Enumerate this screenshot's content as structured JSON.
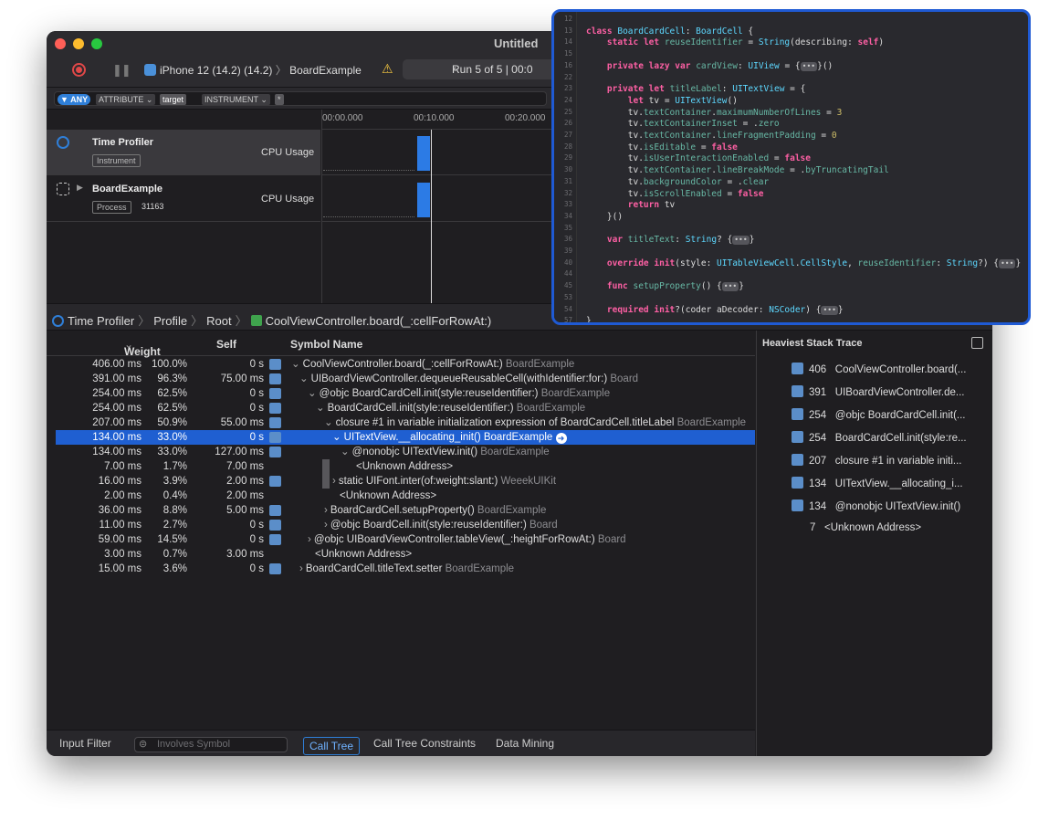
{
  "window": {
    "title": "Untitled"
  },
  "toolbar": {
    "device": "iPhone 12 (14.2) (14.2)",
    "device_sep": "〉",
    "target": "BoardExample",
    "run_prev": "‹",
    "run": "Run 5 of 5  |  00:0"
  },
  "filter": {
    "any": "▼ ANY",
    "attribute": "ATTRIBUTE ⌄",
    "target": "target",
    "instrument": "INSTRUMENT ⌄",
    "star": "*"
  },
  "ruler": [
    "00:00.000",
    "00:10.000",
    "00:20.000"
  ],
  "tracks": [
    {
      "name": "Time Profiler",
      "tag": "Instrument",
      "pid": "",
      "metric": "CPU Usage"
    },
    {
      "name": "BoardExample",
      "tag": "Process",
      "pid": "31163",
      "metric": "CPU Usage"
    }
  ],
  "breadcrumb": {
    "items": [
      "Time Profiler",
      "Profile",
      "Root",
      "CoolViewController.board(_:cellForRowAt:)"
    ],
    "sep": "〉"
  },
  "table": {
    "headers": {
      "weight": "Weight",
      "weight_sort": "⌄",
      "self": "Self",
      "symbol": "Symbol Name"
    },
    "rows": [
      {
        "w": "406.00 ms",
        "p": "100.0%",
        "s": "0 s",
        "icon": true,
        "indent": 0,
        "disc": "⌄",
        "sym": "CoolViewController.board(_:cellForRowAt:)",
        "lib": "BoardExample",
        "sel": false
      },
      {
        "w": "391.00 ms",
        "p": "96.3%",
        "s": "75.00 ms",
        "icon": true,
        "indent": 1,
        "disc": "⌄",
        "sym": "UIBoardViewController.dequeueReusableCell(withIdentifier:for:)",
        "lib": "Board",
        "sel": false
      },
      {
        "w": "254.00 ms",
        "p": "62.5%",
        "s": "0 s",
        "icon": true,
        "indent": 2,
        "disc": "⌄",
        "sym": "@objc BoardCardCell.init(style:reuseIdentifier:)",
        "lib": "BoardExample",
        "sel": false
      },
      {
        "w": "254.00 ms",
        "p": "62.5%",
        "s": "0 s",
        "icon": true,
        "indent": 3,
        "disc": "⌄",
        "sym": "BoardCardCell.init(style:reuseIdentifier:)",
        "lib": "BoardExample",
        "sel": false
      },
      {
        "w": "207.00 ms",
        "p": "50.9%",
        "s": "55.00 ms",
        "icon": true,
        "indent": 4,
        "disc": "⌄",
        "sym": "closure #1 in variable initialization expression of BoardCardCell.titleLabel",
        "lib": "BoardExample",
        "sel": false
      },
      {
        "w": "134.00 ms",
        "p": "33.0%",
        "s": "0 s",
        "icon": true,
        "indent": 5,
        "disc": "⌄",
        "sym": "UITextView.__allocating_init()",
        "lib": "BoardExample",
        "sel": true
      },
      {
        "w": "134.00 ms",
        "p": "33.0%",
        "s": "127.00 ms",
        "icon": true,
        "indent": 6,
        "disc": "⌄",
        "sym": "@nonobjc UITextView.init()",
        "lib": "BoardExample",
        "sel": false
      },
      {
        "w": "7.00 ms",
        "p": "1.7%",
        "s": "7.00 ms",
        "icon": false,
        "indent": 7,
        "disc": "",
        "sym": "<Unknown Address>",
        "lib": "",
        "sel": false
      },
      {
        "w": "16.00 ms",
        "p": "3.9%",
        "s": "2.00 ms",
        "icon": true,
        "indent": 5,
        "disc": "›",
        "sym": "static UIFont.inter(of:weight:slant:)",
        "lib": "WeeekUIKit",
        "sel": false
      },
      {
        "w": "2.00 ms",
        "p": "0.4%",
        "s": "2.00 ms",
        "icon": false,
        "indent": 5,
        "disc": "",
        "sym": "<Unknown Address>",
        "lib": "",
        "sel": false
      },
      {
        "w": "36.00 ms",
        "p": "8.8%",
        "s": "5.00 ms",
        "icon": true,
        "indent": 4,
        "disc": "›",
        "sym": "BoardCardCell.setupProperty()",
        "lib": "BoardExample",
        "sel": false
      },
      {
        "w": "11.00 ms",
        "p": "2.7%",
        "s": "0 s",
        "icon": true,
        "indent": 4,
        "disc": "›",
        "sym": "@objc BoardCell.init(style:reuseIdentifier:)",
        "lib": "Board",
        "sel": false
      },
      {
        "w": "59.00 ms",
        "p": "14.5%",
        "s": "0 s",
        "icon": true,
        "indent": 2,
        "disc": "›",
        "sym": "@objc UIBoardViewController.tableView(_:heightForRowAt:)",
        "lib": "Board",
        "sel": false
      },
      {
        "w": "3.00 ms",
        "p": "0.7%",
        "s": "3.00 ms",
        "icon": false,
        "indent": 2,
        "disc": "",
        "sym": "<Unknown Address>",
        "lib": "",
        "sel": false
      },
      {
        "w": "15.00 ms",
        "p": "3.6%",
        "s": "0 s",
        "icon": true,
        "indent": 1,
        "disc": "›",
        "sym": "BoardCardCell.titleText.setter",
        "lib": "BoardExample",
        "sel": false
      }
    ]
  },
  "heaviest": {
    "title": "Heaviest Stack Trace",
    "items": [
      {
        "n": "406",
        "s": "CoolViewController.board(..."
      },
      {
        "n": "391",
        "s": "UIBoardViewController.de..."
      },
      {
        "n": "254",
        "s": "@objc BoardCardCell.init(..."
      },
      {
        "n": "254",
        "s": "BoardCardCell.init(style:re..."
      },
      {
        "n": "207",
        "s": "closure #1 in variable initi..."
      },
      {
        "n": "134",
        "s": "UITextView.__allocating_i..."
      },
      {
        "n": "134",
        "s": "@nonobjc UITextView.init()"
      },
      {
        "n": "7",
        "s": "<Unknown Address>"
      }
    ]
  },
  "bottom": {
    "input_filter": "Input Filter",
    "symbol_placeholder": "Involves Symbol",
    "call_tree": "Call Tree",
    "constraints": "Call Tree Constraints",
    "data_mining": "Data Mining"
  },
  "code": {
    "line_numbers": [
      "12",
      "13",
      "14",
      "15",
      "16",
      "22",
      "23",
      "24",
      "25",
      "26",
      "27",
      "28",
      "29",
      "30",
      "31",
      "32",
      "33",
      "34",
      "35",
      "36",
      "39",
      "40",
      "44",
      "45",
      "53",
      "54",
      "57"
    ],
    "fold_glyph": "•••",
    "lines": [
      "",
      "class BoardCardCell: BoardCell {",
      "    static let reuseIdentifier = String(describing: self)",
      "",
      "    private lazy var cardView: UIView = {FOLD}()",
      "",
      "    private let titleLabel: UITextView = {",
      "        let tv = UITextView()",
      "        tv.textContainer.maximumNumberOfLines = 3",
      "        tv.textContainerInset = .zero",
      "        tv.textContainer.lineFragmentPadding = 0",
      "        tv.isEditable = false",
      "        tv.isUserInteractionEnabled = false",
      "        tv.textContainer.lineBreakMode = .byTruncatingTail",
      "        tv.backgroundColor = .clear",
      "        tv.isScrollEnabled = false",
      "        return tv",
      "    }()",
      "",
      "    var titleText: String? {FOLD}",
      "",
      "    override init(style: UITableViewCell.CellStyle, reuseIdentifier: String?) {FOLD}",
      "",
      "    func setupProperty() {FOLD}",
      "",
      "    required init?(coder aDecoder: NSCoder) {FOLD}",
      "}"
    ]
  }
}
